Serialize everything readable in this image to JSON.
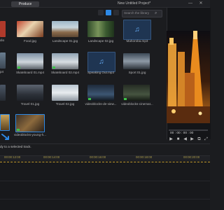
{
  "header": {
    "tab_produce": "Produce",
    "project_title": "New Untitled Project*",
    "minimize_glyph": "—",
    "close_glyph": "✕"
  },
  "library": {
    "search_placeholder": "Search the library",
    "items": [
      {
        "label": "Food.jpg"
      },
      {
        "label": "Landscape 01.jpg"
      },
      {
        "label": "Landscape 02.jpg"
      },
      {
        "label": "Mahoroba.mp3"
      },
      {
        "label": "Skateboard 01.mp4"
      },
      {
        "label": "Skateboard 02.mp4"
      },
      {
        "label": "Speaking Out.mp3"
      },
      {
        "label": "Sport 01.jpg"
      },
      {
        "label": "Travel 01.jpg"
      },
      {
        "label": "Travel 02.jpg"
      },
      {
        "label": "videoblocks-de-view..."
      },
      {
        "label": "videoblocks-cinemat..."
      },
      {
        "label": "videoblocks-young-h..."
      }
    ],
    "partial_labels": {
      "row0": "dio",
      "row1": "p4"
    }
  },
  "preview": {
    "timecode": "00 : 00 : 00 : 00"
  },
  "controls": {
    "play": "▶",
    "stop": "■",
    "prev": "◀",
    "next": "▶",
    "snapshot": "⧉",
    "fullscreen": "⤢"
  },
  "status": {
    "tooltip": "dy to a selected track."
  },
  "ruler": {
    "labels": [
      "00:00:12:00",
      "00:00:14:00",
      "00:00:16:00",
      "00:00:18:00",
      "00:00:20:00"
    ]
  },
  "icons": {
    "search": "search-icon",
    "audio": "music-note-icon"
  },
  "colors": {
    "accent": "#2d89e6",
    "timeline_marker": "#c29a2c",
    "badge_green": "#3ec24a"
  }
}
